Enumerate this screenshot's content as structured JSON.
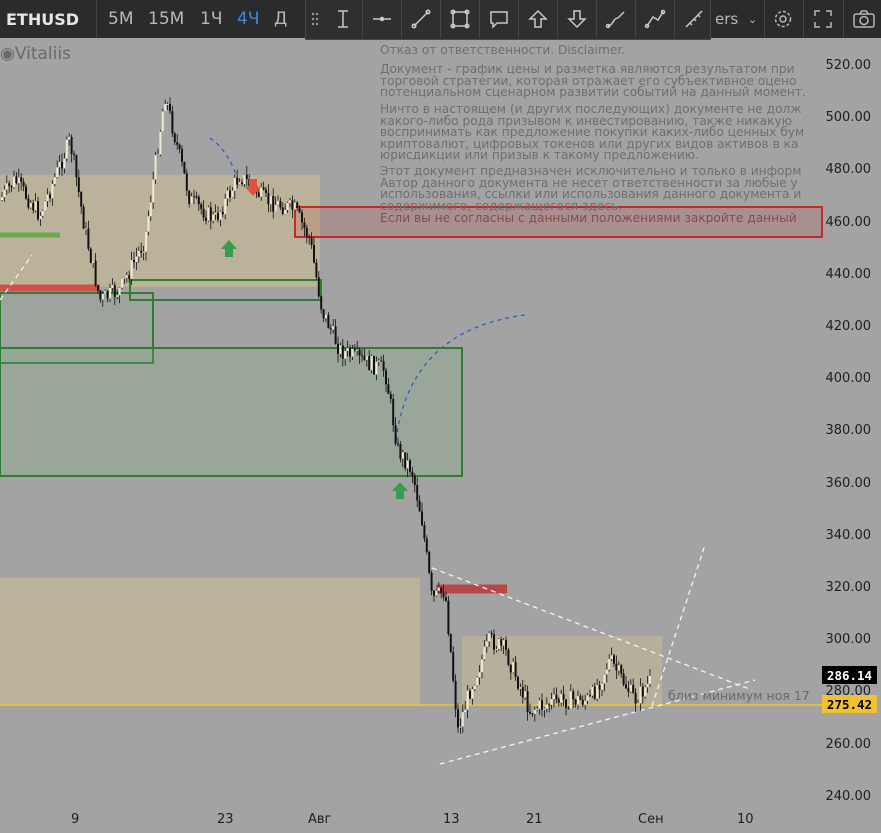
{
  "toolbar": {
    "symbol": "ETHUSD",
    "intervals": [
      {
        "label": "5M",
        "active": false
      },
      {
        "label": "15M",
        "active": false
      },
      {
        "label": "1Ч",
        "active": false
      },
      {
        "label": "4Ч",
        "active": true
      },
      {
        "label": "Д",
        "active": false
      }
    ],
    "indicators_label": "ers",
    "icons": [
      "chevron-down-icon",
      "gear-icon",
      "fullscreen-icon",
      "camera-icon"
    ]
  },
  "drawing_toolbar": {
    "icons": [
      "drag-handle-icon",
      "text-cursor-icon",
      "horizontal-line-icon",
      "trend-line-icon",
      "rectangle-icon",
      "callout-icon",
      "arrow-up-icon",
      "arrow-down-icon",
      "brush-icon",
      "path-icon",
      "ruler-icon"
    ]
  },
  "watermark": "Vitaliis",
  "disclaimer": {
    "title": "Отказ от ответственности. Disclaimer.",
    "p1": [
      "Документ - график цены и разметка являются результатом при",
      "торговой стратегии, которая отражает его субъективное оцено",
      "потенциальном сценарном развитии событий на данный момент."
    ],
    "p2": [
      "Ничто в настоящем (и других последующих) документе не долж",
      "какого-либо рода призывом к инвестированию, также никакую",
      "воспринимать как предложение покупки каких-либо ценных бум",
      "криптовалют, цифровых токенов или других видов активов в ка",
      "юрисдикции или призыв к такому предложению."
    ],
    "p3": [
      "Этот документ предназначен исключительно и только в информ",
      "Автор данного документа не несет ответственности за любые у",
      "использования, ссылки или использования данного документа и",
      "содержимого, содержащегося здесь."
    ],
    "p4": "Если вы не согласны с данными положениями закройте данный"
  },
  "price_axis": [
    "520.00",
    "500.00",
    "480.00",
    "460.00",
    "440.00",
    "420.00",
    "400.00",
    "380.00",
    "360.00",
    "340.00",
    "320.00",
    "300.00",
    "280.00",
    "260.00",
    "240.00"
  ],
  "time_axis": [
    "9",
    "23",
    "Авг",
    "13",
    "21",
    "Сен",
    "10"
  ],
  "price_tags": {
    "last": {
      "value": "286.14",
      "bg": "#000000",
      "fg": "#ffffff"
    },
    "level": {
      "value": "275.42",
      "bg": "#f2c12e",
      "fg": "#000000"
    }
  },
  "annotation": "близ минимум ноя 17",
  "colors": {
    "background": "#a3a3a3",
    "toolbar": "#2b2b2b",
    "accent": "#3a8ad6",
    "demand_zone": "#cfc39a",
    "support_box": "#2e7d32",
    "resistance_box": "#c62828",
    "level_line": "#f2c12e"
  }
}
